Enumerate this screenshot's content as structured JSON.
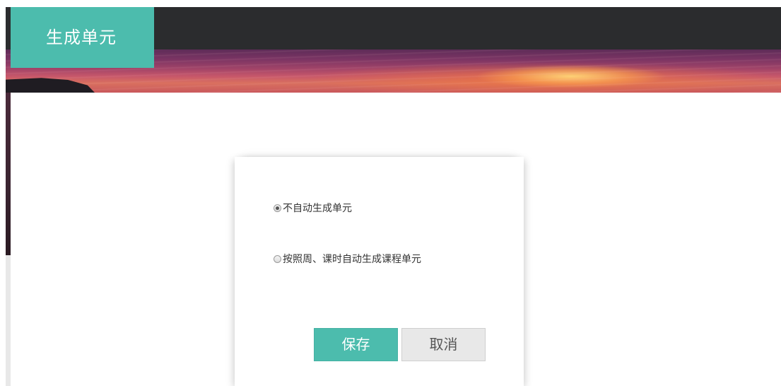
{
  "header": {
    "title": "生成单元"
  },
  "dialog": {
    "options": [
      {
        "label": "不自动生成单元",
        "checked": true
      },
      {
        "label": "按照周、课时自动生成课程单元",
        "checked": false
      }
    ],
    "save_label": "保存",
    "cancel_label": "取消"
  },
  "colors": {
    "accent": "#4cbcad",
    "top_bar": "#2b2c2e",
    "cancel_bg": "#e8e8e8"
  }
}
